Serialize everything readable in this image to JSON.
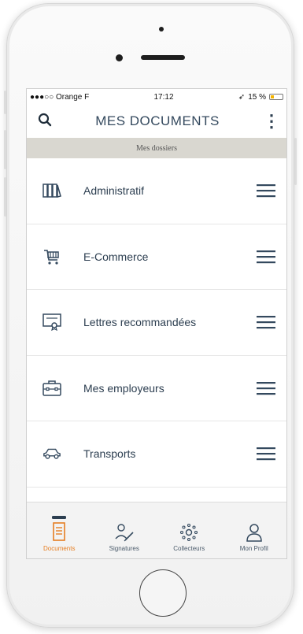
{
  "status": {
    "carrier": "●●●○○ Orange F",
    "time": "17:12",
    "battery": "15 %"
  },
  "header": {
    "title": "MES DOCUMENTS",
    "menu_glyph": "⋮"
  },
  "subheader": {
    "label": "Mes dossiers"
  },
  "folders": [
    {
      "label": "Administratif",
      "icon": "binders-icon"
    },
    {
      "label": "E-Commerce",
      "icon": "shopping-cart-icon"
    },
    {
      "label": "Lettres recommandées",
      "icon": "certificate-icon"
    },
    {
      "label": "Mes employeurs",
      "icon": "briefcase-icon"
    },
    {
      "label": "Transports",
      "icon": "car-icon"
    }
  ],
  "tabs": [
    {
      "label": "Documents",
      "icon": "documents-icon",
      "active": true
    },
    {
      "label": "Signatures",
      "icon": "signature-icon",
      "active": false
    },
    {
      "label": "Collecteurs",
      "icon": "collectors-icon",
      "active": false
    },
    {
      "label": "Mon Profil",
      "icon": "profile-icon",
      "active": false
    }
  ],
  "colors": {
    "accent": "#e67e22",
    "text": "#2c3e50",
    "subheader_bg": "#d9d7d0"
  }
}
